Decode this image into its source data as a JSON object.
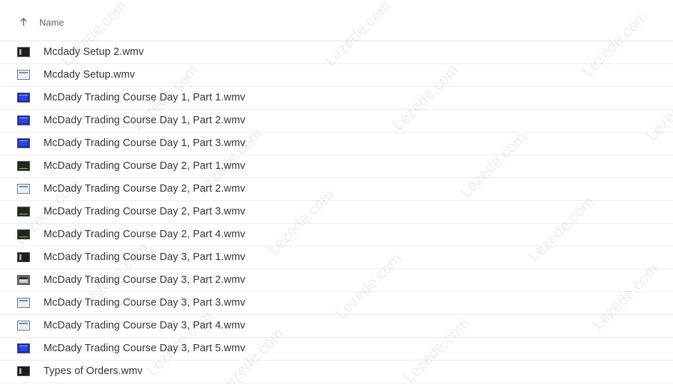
{
  "header": {
    "column_label": "Name",
    "sort_icon": "arrow-up-icon"
  },
  "files": [
    {
      "name": "Mcdady Setup 2.wmv",
      "thumb": "dark"
    },
    {
      "name": "Mcdady Setup.wmv",
      "thumb": "light"
    },
    {
      "name": "McDady Trading Course Day 1, Part 1.wmv",
      "thumb": "blue"
    },
    {
      "name": "McDady Trading Course Day 1, Part 2.wmv",
      "thumb": "blue"
    },
    {
      "name": "McDady Trading Course Day 1, Part 3.wmv",
      "thumb": "blue"
    },
    {
      "name": "McDady Trading Course Day 2, Part 1.wmv",
      "thumb": "darkchart"
    },
    {
      "name": "McDady Trading Course Day 2, Part 2.wmv",
      "thumb": "light"
    },
    {
      "name": "McDady Trading Course Day 2, Part 3.wmv",
      "thumb": "darkchart"
    },
    {
      "name": "McDady Trading Course Day 2, Part 4.wmv",
      "thumb": "darkchart"
    },
    {
      "name": "McDady Trading Course Day 3, Part 1.wmv",
      "thumb": "dark"
    },
    {
      "name": "McDady Trading Course Day 3, Part 2.wmv",
      "thumb": "gray"
    },
    {
      "name": "McDady Trading Course Day 3, Part 3.wmv",
      "thumb": "light"
    },
    {
      "name": "McDady Trading Course Day 3, Part 4.wmv",
      "thumb": "light"
    },
    {
      "name": "McDady Trading Course Day 3, Part 5.wmv",
      "thumb": "blue"
    },
    {
      "name": "Types of Orders.wmv",
      "thumb": "dark"
    }
  ],
  "watermark": "Lezede.com",
  "colors": {
    "dark": "#1c1c1c",
    "light": "#e8eef4",
    "blue": "#1a2fb0",
    "darkchart": "#20281c",
    "gray": "#6b6b6b"
  }
}
